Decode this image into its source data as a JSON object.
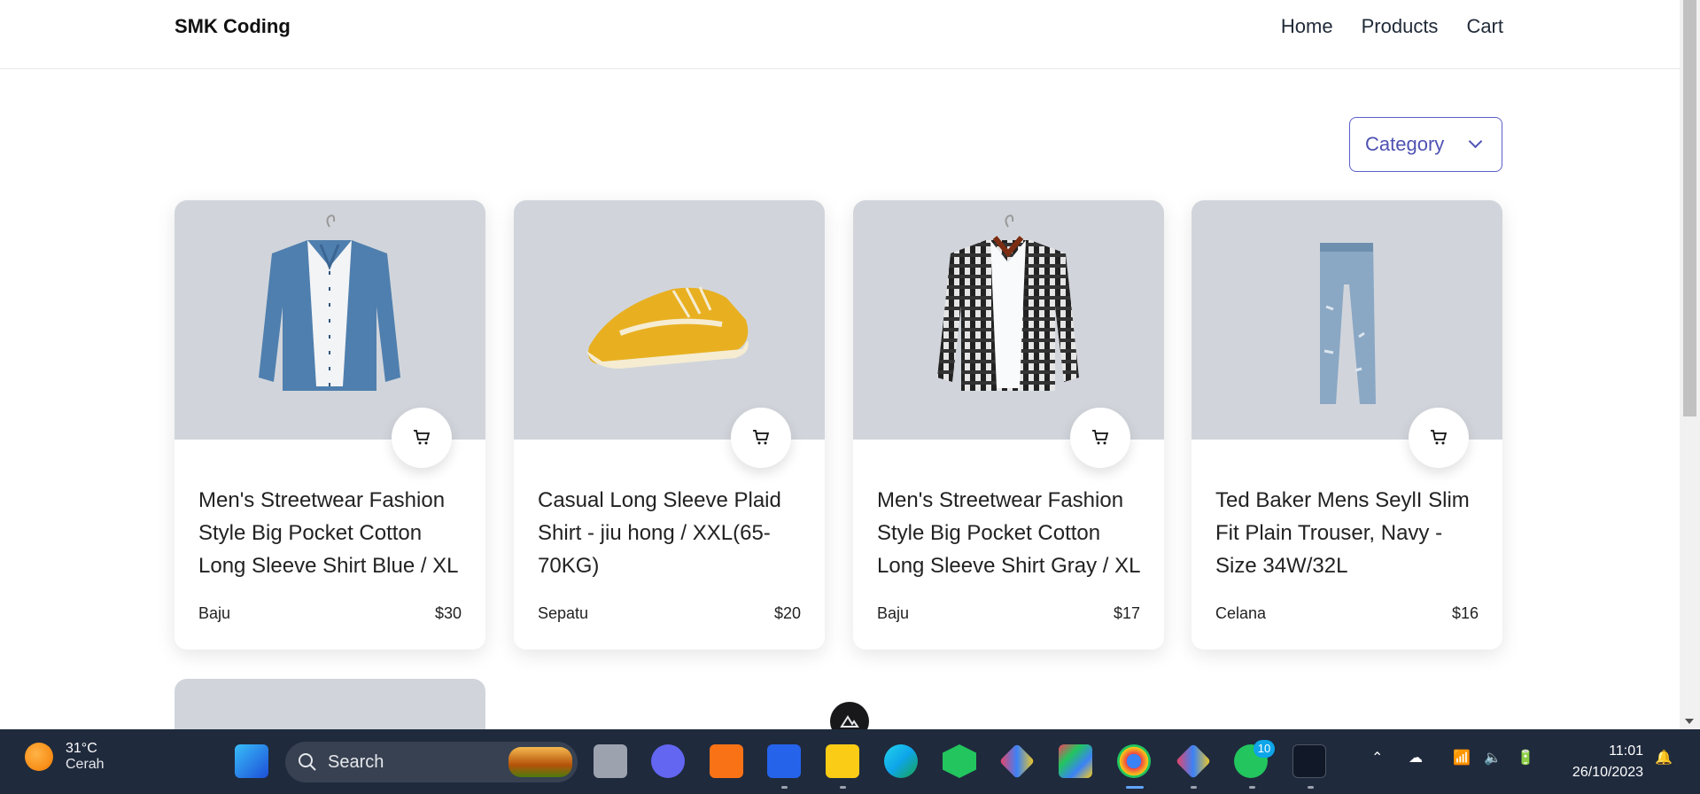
{
  "header": {
    "brand": "SMK Coding",
    "nav": [
      "Home",
      "Products",
      "Cart"
    ]
  },
  "filter": {
    "category_label": "Category"
  },
  "products": [
    {
      "title": "Men's Streetwear Fashion Style Big Pocket Cotton Long Sleeve Shirt Blue / XL",
      "category": "Baju",
      "price": "$30",
      "image": "blue-denim-shirt"
    },
    {
      "title": "Casual Long Sleeve Plaid Shirt - jiu hong / XXL(65-70KG)",
      "category": "Sepatu",
      "price": "$20",
      "image": "yellow-sneaker"
    },
    {
      "title": "Men's Streetwear Fashion Style Big Pocket Cotton Long Sleeve Shirt Gray / XL",
      "category": "Baju",
      "price": "$17",
      "image": "plaid-shirt"
    },
    {
      "title": "Ted Baker Mens SeylI Slim Fit Plain Trouser, Navy - Size 34W/32L",
      "category": "Celana",
      "price": "$16",
      "image": "blue-jeans"
    }
  ],
  "taskbar": {
    "weather_temp": "31°C",
    "weather_desc": "Cerah",
    "search_placeholder": "Search",
    "whatsapp_badge": "10",
    "time": "11:01",
    "date": "26/10/2023"
  },
  "colors": {
    "accent": "#4f52b2",
    "image_bg": "#d1d5db",
    "taskbar_bg": "#1f2a3d"
  }
}
